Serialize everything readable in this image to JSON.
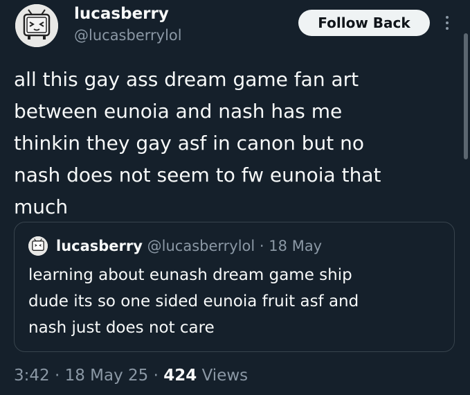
{
  "author": {
    "display_name": "lucasberry",
    "handle": "@lucasberrylol",
    "avatar_icon": "tv-face-avatar-icon"
  },
  "follow_button": {
    "label": "Follow Back"
  },
  "more_icon": "more-vertical-icon",
  "tweet": {
    "lines": [
      "all this gay ass dream game fan art",
      "between eunoia and nash has me",
      "thinkin they gay asf in canon but no",
      "nash does not seem to fw eunoia that",
      "much"
    ]
  },
  "quoted_tweet": {
    "display_name": "lucasberry",
    "handle": "@lucasberrylol",
    "separator": "·",
    "date": "18 May",
    "lines": [
      "learning about eunash dream game ship",
      "dude its so one sided eunoia fruit asf and",
      "nash just does not care"
    ]
  },
  "meta": {
    "time": "3:42",
    "sep1": "·",
    "date": "18 May 25",
    "sep2": "·",
    "views_count": "424",
    "views_label": "Views"
  },
  "colors": {
    "background": "#15202b",
    "text_primary": "#f7f9f9",
    "text_secondary": "#8b98a5",
    "border": "#38444d",
    "button_bg": "#eff3f4",
    "button_text": "#0f1419"
  }
}
